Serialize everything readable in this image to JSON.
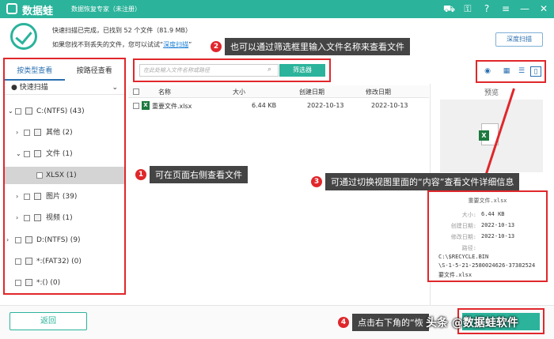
{
  "titlebar": {
    "app_name": "数据蛙",
    "subtitle": "数据恢复专家（未注册）",
    "icons": [
      "cart-icon",
      "key-icon",
      "help-icon",
      "menu-icon",
      "minimize-icon",
      "close-icon"
    ]
  },
  "header": {
    "status_line1": "快速扫描已完成，已找到 52 个文件（81.9 MB）",
    "status_line2_prefix": "如果您找不到丢失的文件，您可以试试“",
    "deep_scan_link": "深度扫描",
    "status_line2_suffix": "”",
    "deep_scan_button": "深度扫描"
  },
  "callouts": [
    {
      "num": "2",
      "text": "也可以通过筛选框里输入文件名称来查看文件"
    },
    {
      "num": "1",
      "text": "可在页面右侧查看文件"
    },
    {
      "num": "3",
      "text": "可通过切换视图里面的“内容”查看文件详细信息"
    },
    {
      "num": "4",
      "text": "点击右下角的“恢"
    }
  ],
  "sidebar": {
    "tab_type": "按类型查看",
    "tab_path": "按路径查看",
    "quick_scan": "快速扫描",
    "items": [
      {
        "label": "C:(NTFS) (43)"
      },
      {
        "label": "其他 (2)"
      },
      {
        "label": "文件 (1)"
      },
      {
        "label": "XLSX (1)"
      },
      {
        "label": "图片 (39)"
      },
      {
        "label": "视频 (1)"
      },
      {
        "label": "D:(NTFS) (9)"
      },
      {
        "label": "*:(FAT32) (0)"
      },
      {
        "label": "*:() (0)"
      }
    ]
  },
  "toolbar": {
    "search_placeholder": "在此处输入文件名称或路径",
    "filter_button": "筛选器"
  },
  "table": {
    "headers": {
      "name": "名称",
      "size": "大小",
      "created": "创建日期",
      "modified": "修改日期"
    },
    "rows": [
      {
        "name": "重要文件.xlsx",
        "size": "6.44 KB",
        "created": "2022-10-13",
        "modified": "2022-10-13"
      }
    ]
  },
  "preview": {
    "label": "预览",
    "detail_title": "重要文件.xlsx",
    "size_key": "大小:",
    "size_val": "6.44 KB",
    "created_key": "创建日期:",
    "created_val": "2022-10-13",
    "modified_key": "修改日期:",
    "modified_val": "2022-10-13",
    "path_key": "路径:",
    "path_line1": "C:\\$RECYCLE.BIN",
    "path_line2": "\\S-1-5-21-2580024626-37382524",
    "path_line3": "要文件.xlsx"
  },
  "footer": {
    "back_button": "返回",
    "watermark": "头条 @数据蛙软件"
  },
  "colors": {
    "brand": "#2bb39b",
    "highlight": "#e0272b",
    "link": "#1a7fd6"
  }
}
